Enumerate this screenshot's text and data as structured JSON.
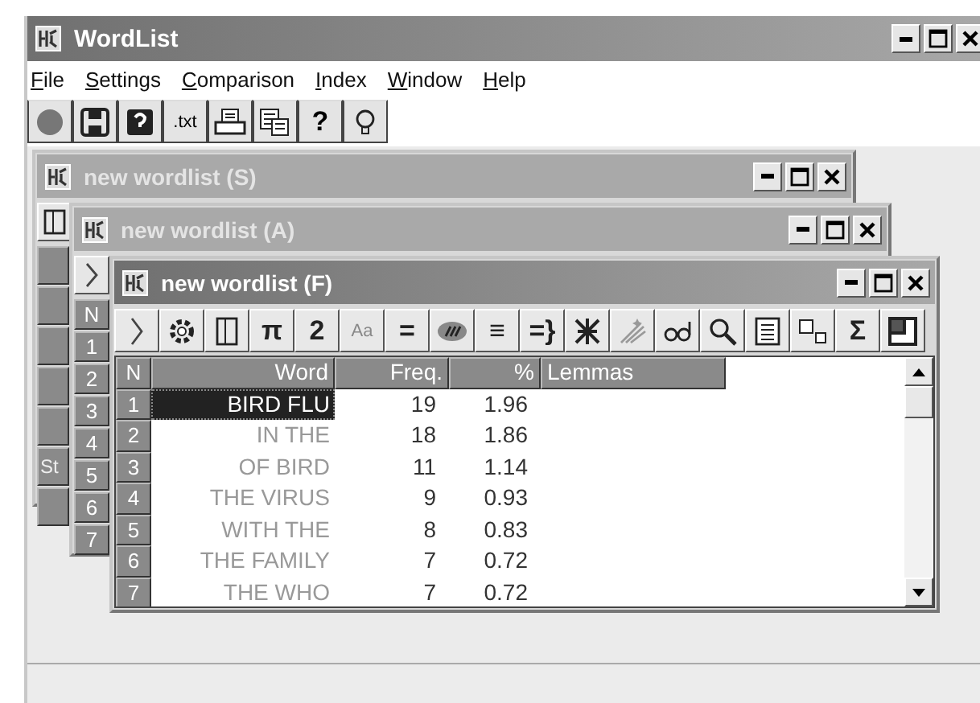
{
  "window": {
    "title": "WordList"
  },
  "menu": [
    {
      "label": "File"
    },
    {
      "label": "Settings"
    },
    {
      "label": "Comparison"
    },
    {
      "label": "Index"
    },
    {
      "label": "Window"
    },
    {
      "label": "Help"
    }
  ],
  "toolbar": [
    {
      "kind": "stop"
    },
    {
      "kind": "save"
    },
    {
      "kind": "help-disk"
    },
    {
      "kind": "text",
      "label": ".txt"
    },
    {
      "kind": "print"
    },
    {
      "kind": "copy"
    },
    {
      "kind": "text",
      "label": "?"
    },
    {
      "kind": "bulb"
    }
  ],
  "child_windows": [
    {
      "title": "new wordlist (S)",
      "active": false,
      "side_cells": [
        "",
        "",
        "",
        "",
        "",
        "St",
        ""
      ]
    },
    {
      "title": "new wordlist (A)",
      "active": false,
      "header": "N",
      "row_numbers": [
        "1",
        "2",
        "3",
        "4",
        "5",
        "6",
        "7"
      ]
    },
    {
      "title": "new wordlist (F)",
      "active": true,
      "toolbar": [
        {
          "kind": "chevron"
        },
        {
          "kind": "gear"
        },
        {
          "kind": "columns"
        },
        {
          "kind": "text",
          "label": "π"
        },
        {
          "kind": "text",
          "label": "2"
        },
        {
          "kind": "small-text",
          "label": "Aa"
        },
        {
          "kind": "text",
          "label": "="
        },
        {
          "kind": "oval"
        },
        {
          "kind": "text",
          "label": "≡"
        },
        {
          "kind": "text",
          "label": "=}"
        },
        {
          "kind": "scissors"
        },
        {
          "kind": "wand"
        },
        {
          "kind": "glasses"
        },
        {
          "kind": "search"
        },
        {
          "kind": "document"
        },
        {
          "kind": "boxes"
        },
        {
          "kind": "text",
          "label": "Σ"
        },
        {
          "kind": "window"
        }
      ],
      "table": {
        "columns": [
          "N",
          "Word",
          "Freq.",
          "%",
          "Lemmas"
        ],
        "rows": [
          {
            "n": "1",
            "word": "BIRD FLU",
            "freq": "19",
            "pct": "1.96",
            "selected": true
          },
          {
            "n": "2",
            "word": "IN THE",
            "freq": "18",
            "pct": "1.86",
            "selected": false
          },
          {
            "n": "3",
            "word": "OF BIRD",
            "freq": "11",
            "pct": "1.14",
            "selected": false
          },
          {
            "n": "4",
            "word": "THE VIRUS",
            "freq": "9",
            "pct": "0.93",
            "selected": false
          },
          {
            "n": "5",
            "word": "WITH THE",
            "freq": "8",
            "pct": "0.83",
            "selected": false
          },
          {
            "n": "6",
            "word": "THE FAMILY",
            "freq": "7",
            "pct": "0.72",
            "selected": false
          },
          {
            "n": "7",
            "word": "THE WHO",
            "freq": "7",
            "pct": "0.72",
            "selected": false
          }
        ]
      }
    }
  ]
}
